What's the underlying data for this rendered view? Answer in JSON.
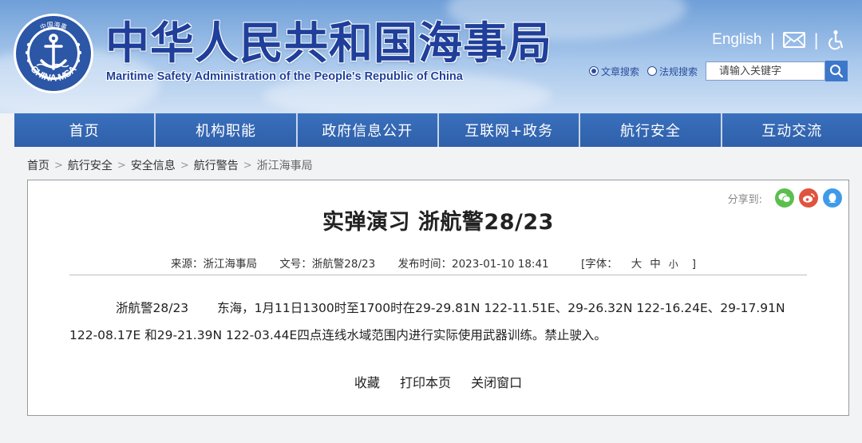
{
  "header": {
    "emblem_text": "CHINA MSA",
    "emblem_cn": "中国海事",
    "title": "中华人民共和国海事局",
    "subtitle": "Maritime Safety Administration of the People's Republic of China",
    "english_link": "English",
    "separator": "|",
    "mail_icon": "mail-icon",
    "accessibility_icon": "accessibility-icon"
  },
  "search": {
    "options": [
      {
        "label": "文章搜索",
        "selected": true
      },
      {
        "label": "法规搜索",
        "selected": false
      }
    ],
    "placeholder": "请输入关键字",
    "button_icon": "search-icon"
  },
  "nav": {
    "items": [
      "首页",
      "机构职能",
      "政府信息公开",
      "互联网+政务",
      "航行安全",
      "互动交流"
    ]
  },
  "breadcrumb": {
    "items": [
      "首页",
      "航行安全",
      "安全信息",
      "航行警告"
    ],
    "current": "浙江海事局",
    "separator": ">"
  },
  "article": {
    "share_label": "分享到:",
    "share_icons": [
      "wechat-icon",
      "weibo-icon",
      "qq-icon"
    ],
    "title": "实弹演习 浙航警28/23",
    "meta": {
      "source": "来源：浙江海事局",
      "doc_no": "文号：浙航警28/23",
      "published": "发布时间：2023-01-10 18:41",
      "font_label": "[字体：",
      "font_large": "大",
      "font_medium": "中",
      "font_small": "小",
      "font_close": "]"
    },
    "body_code": "浙航警28/23",
    "body_line1": "东海，1月11日1300时至1700时在29-29.81N  122-11.51E、29-26.32N 122-16.24E、29-17.91N",
    "body_line2": "122-08.17E 和29-21.39N 122-03.44E四点连线水域范围内进行实际使用武器训练。禁止驶入。",
    "actions": [
      "收藏",
      "打印本页",
      "关闭窗口"
    ]
  },
  "colors": {
    "brand_blue": "#1f3f9a",
    "nav_blue": "#3566b0",
    "wechat_green": "#5bbf4e",
    "weibo_red": "#e0533e",
    "qq_blue": "#3f9bea"
  }
}
